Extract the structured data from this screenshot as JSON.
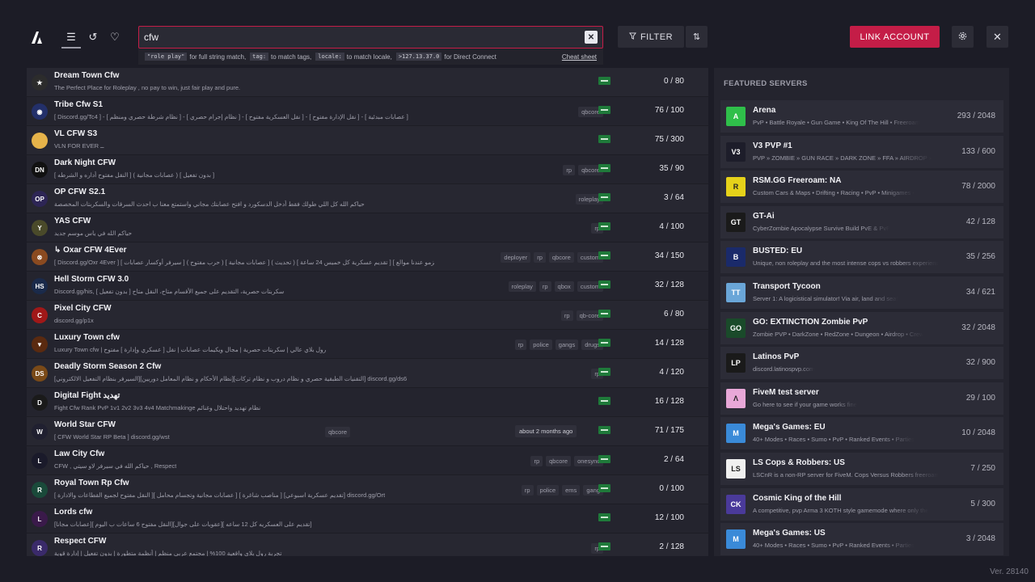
{
  "search": {
    "value": "cfw",
    "clear_label": "✕"
  },
  "search_hint": {
    "code1": "\"role play\"",
    "text1": "for full string match,",
    "code2": "tag:",
    "text2": "to match tags,",
    "code3": "locale:",
    "text3": "to match locale,",
    "code4": ">127.13.37.0",
    "text4": "for Direct Connect",
    "cheat_sheet": "Cheat sheet"
  },
  "toolbar": {
    "filter_label": "FILTER",
    "link_account_label": "LINK ACCOUNT"
  },
  "featured_title": "FEATURED SERVERS",
  "servers": [
    {
      "name": "Dream Town Cfw",
      "desc": "The Perfect Place for Roleplay , no pay to win, just fair play and pure.",
      "tags": [],
      "count": "0 / 80",
      "icon_color": "#2c2c2c",
      "icon_text": "★"
    },
    {
      "name": "Tribe Cfw S1",
      "desc": "[ Discord.gg/Tc4 ] - [ نظام شرطة حصري ومنظم ] - [ نظام إجرام حصري ] - [ نقل العسكرية مفتوح ] - [ نقل الإدارة مفتوح ] - [ عصابات مبدئية ]",
      "tags": [
        "qbcore"
      ],
      "count": "76 / 100",
      "icon_color": "#23306a",
      "icon_text": "◉"
    },
    {
      "name": "VL CFW S3",
      "desc": "VLN FOR EVER ــ",
      "tags": [],
      "count": "75 / 300",
      "icon_color": "#e6b34a",
      "icon_text": ""
    },
    {
      "name": "Dark Night CFW",
      "desc": "[ النقل مفتوح أداره و الشرطه ] ( عصابات مجانية ) [ بدون تفعيل ]",
      "tags": [
        "rp",
        "qbcore"
      ],
      "count": "35 / 90",
      "icon_color": "#111111",
      "icon_text": "DN"
    },
    {
      "name": "OP CFW S2.1",
      "desc": "حياكم الله كل اللي طولك فقط أدخل الدسكورد و افتح عصابتك مجاني واستمتع معنا ب احدث السرقات والسكربتات المخصصة",
      "tags": [
        "roleplay"
      ],
      "count": "3 / 64",
      "icon_color": "#2d2555",
      "icon_text": "OP"
    },
    {
      "name": "YAS CFW",
      "desc": "حياكم الله في ياس موسم جديد",
      "tags": [
        "rp"
      ],
      "count": "4 / 100",
      "icon_color": "#4a4a2a",
      "icon_text": "Y"
    },
    {
      "name": "↳ Oxar CFW 4Ever",
      "desc": "[ Discord.gg/Oxr 4Ever ] [ سيرفر أوكسار عصابات ] ( حرب مفتوح ) [ عصابات مجانية ] ( تحديث ) [ تقديم عسكرية كل خميس 24 ساعة ] [ الكاريزمو عندنا موالع ] ب",
      "tags": [
        "deployer",
        "rp",
        "qbcore",
        "custom"
      ],
      "count": "34 / 150",
      "icon_color": "#8a4a20",
      "icon_text": "⊗"
    },
    {
      "name": "Hell Storm CFW 3.0",
      "desc": "Discord.gg/his, سكربتات حصرية، التقديم على جميع الأقسام متاح، النقل متاح [ بدون تفعيل ]",
      "tags": [
        "roleplay",
        "rp",
        "qbox",
        "custom"
      ],
      "count": "32 / 128",
      "icon_color": "#1a2a4a",
      "icon_text": "HS"
    },
    {
      "name": "Pixel City CFW",
      "desc": "discord.gg/p1x",
      "tags": [
        "rp",
        "qb-core"
      ],
      "count": "6 / 80",
      "icon_color": "#a01818",
      "icon_text": "C"
    },
    {
      "name": "Luxury Town cfw",
      "desc": "Luxury Town cfw | رول بلاي عالي | سكربتات حصرية | مجال ويكيمات عصابات | نقل [ عسكري وإدارة ] مفتوح",
      "tags": [
        "rp",
        "police",
        "gangs",
        "drugs"
      ],
      "count": "14 / 128",
      "icon_color": "#5a2a10",
      "icon_text": "▼"
    },
    {
      "name": "Deadly Storm Season 2 Cfw",
      "desc": "[السيرفر بنظام التفعيل الالكتروني][نظام الأحكام و نظام المعامل دوريين][التقنيات الطبقية حصري و نظام دروب و نظام تركات] discord.gg/ds6",
      "tags": [
        "rp"
      ],
      "count": "4 / 120",
      "icon_color": "#7a4a18",
      "icon_text": "DS"
    },
    {
      "name": "Digital Fight تهديد",
      "desc": "Fight Cfw Rank PvP 1v1 2v2 3v3 4v4 Matchmakinge نظام تهديد واحتلال وغنائم",
      "tags": [],
      "count": "16 / 128",
      "icon_color": "#1a1a1a",
      "icon_text": "D"
    },
    {
      "name": "World Star CFW",
      "desc": "[ CFW World Star RP Beta ] discord.gg/wst",
      "tags": [
        "qbcore"
      ],
      "ago": "about 2 months ago",
      "count": "71 / 175",
      "icon_color": "#202030",
      "icon_text": "W"
    },
    {
      "name": "Law City Cfw",
      "desc": "CFW , حياكم الله في سيرفر لاو سيتي , Respect",
      "tags": [
        "rp",
        "qbcore",
        "onesync"
      ],
      "count": "2 / 64",
      "icon_color": "#1a1a2a",
      "icon_text": "L"
    },
    {
      "name": "Royal Town Rp Cfw",
      "desc": "[ النقل مفتوح لجميع القطاعات والادارة ][ عصابات مجانية وتجسام محامل ] [ مناصب شاغرة ] [تقديم عسكرية اسبوعي] discord.gg/Ort",
      "tags": [
        "rp",
        "police",
        "ems",
        "gang"
      ],
      "count": "0 / 100",
      "icon_color": "#1a4a3a",
      "icon_text": "R"
    },
    {
      "name": "Lords cfw",
      "desc": "[عصابات مجانا][ النقل مفتوح 6 ساعات ب اليوم][عقوبات على جوال][ تقديم على العسكريه كل 12 ساعه]",
      "tags": [],
      "count": "12 / 100",
      "icon_color": "#3a1a4a",
      "icon_text": "L"
    },
    {
      "name": "Respect CFW",
      "desc": "تجربة رول بلاي واقعية 100% | مجتمع عربي منظم | أنظمة متطورة | بدون تفعيل | إدارة قوية",
      "tags": [
        "rp"
      ],
      "count": "2 / 128",
      "icon_color": "#3a2a6a",
      "icon_text": "R"
    }
  ],
  "featured": [
    {
      "name": "Arena",
      "desc": "PvP • Battle Royale • Gun Game • King Of The Hill • Freeroam",
      "count": "293 / 2048",
      "icon_color": "#2fbf4a",
      "icon_text": "A"
    },
    {
      "name": "V3 PVP #1",
      "desc": "PVP » ZOMBIE » GUN RACE » DARK ZONE » FFA » AIRDROP »",
      "count": "133 / 600",
      "icon_color": "#1d1d2a",
      "icon_text": "V3"
    },
    {
      "name": "RSM.GG Freeroam: NA",
      "desc": "Custom Cars & Maps • Drifting • Racing • PvP • Minigames •",
      "count": "78 / 2000",
      "icon_color": "#e6d21a",
      "icon_text": "R"
    },
    {
      "name": "GT-Ai",
      "desc": "CyberZombie Apocalypse Survive Build PvE & PvP",
      "count": "42 / 128",
      "icon_color": "#1a1a1a",
      "icon_text": "GT"
    },
    {
      "name": "BUSTED: EU",
      "desc": "Unique, non roleplay and the most intense cops vs robbers experience",
      "count": "35 / 256",
      "icon_color": "#1a2a6a",
      "icon_text": "B"
    },
    {
      "name": "Transport Tycoon",
      "desc": "Server 1: A logicistical simulator! Via air, land and sea!",
      "count": "34 / 621",
      "icon_color": "#6aa6d8",
      "icon_text": "TT"
    },
    {
      "name": "GO: EXTINCTION Zombie PvP",
      "desc": "Zombie PVP • DarkZone • RedZone • Dungeon • Airdrop • Crew",
      "count": "32 / 2048",
      "icon_color": "#1a4a2a",
      "icon_text": "GO"
    },
    {
      "name": "Latinos PvP",
      "desc": "discord.latinospvp.com",
      "count": "32 / 900",
      "icon_color": "#1a1a1a",
      "icon_text": "LP"
    },
    {
      "name": "FiveM test server",
      "desc": "Go here to see if your game works fine",
      "count": "29 / 100",
      "icon_color": "#e8a8d8",
      "icon_text": "Λ"
    },
    {
      "name": "Mega's Games: EU",
      "desc": "40+ Modes • Races • Sumo • PvP • Ranked Events • Parties",
      "count": "10 / 2048",
      "icon_color": "#3a8ad8",
      "icon_text": "M"
    },
    {
      "name": "LS Cops & Robbers: US",
      "desc": "LSCnR is a non-RP server for FiveM. Cops Versus Robbers freeroam",
      "count": "7 / 250",
      "icon_color": "#f0f0f0",
      "icon_text": "LS"
    },
    {
      "name": "Cosmic King of the Hill",
      "desc": "A competitive, pvp Arma 3 KOTH style gamemode where only the",
      "count": "5 / 300",
      "icon_color": "#4a3a9a",
      "icon_text": "CK"
    },
    {
      "name": "Mega's Games: US",
      "desc": "40+ Modes • Races • Sumo • PvP • Ranked Events • Parties",
      "count": "3 / 2048",
      "icon_color": "#3a8ad8",
      "icon_text": "M"
    }
  ],
  "version": "Ver. 28140"
}
